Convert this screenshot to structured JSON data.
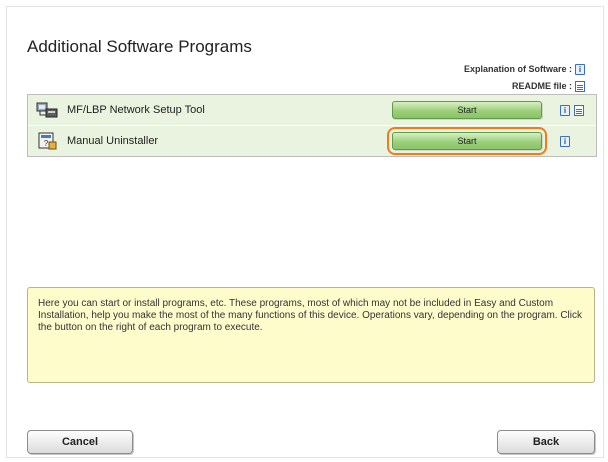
{
  "page": {
    "title": "Additional Software Programs"
  },
  "legend": {
    "explanation_label": "Explanation of Software :",
    "readme_label": "README file :"
  },
  "programs": [
    {
      "name": "MF/LBP Network Setup Tool",
      "start_label": "Start",
      "icon": "network-tool-icon",
      "has_readme": true
    },
    {
      "name": "Manual Uninstaller",
      "start_label": "Start",
      "icon": "uninstaller-icon",
      "has_readme": false
    }
  ],
  "description": "Here you can start or install programs, etc. These programs, most of which may not be included in Easy and Custom Installation, help you make the most of the many functions of this device. Operations vary, depending on the program. Click the button on the right of each program to execute.",
  "footer": {
    "cancel_label": "Cancel",
    "back_label": "Back"
  },
  "colors": {
    "row_bg": "#e9f3df",
    "start_button": "#9ccf7b",
    "highlight": "#ef7d1a",
    "description_bg": "#fffccc"
  }
}
